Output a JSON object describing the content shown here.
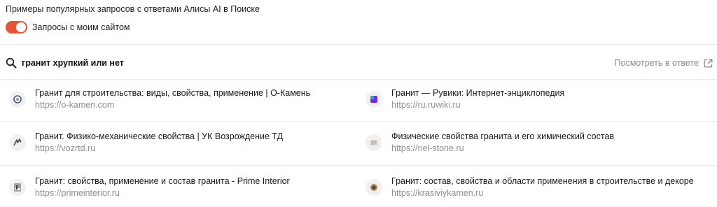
{
  "heading": "Примеры популярных запросов с ответами Алисы AI в Поиске",
  "toggle": {
    "label": "Запросы с моим сайтом",
    "on": true,
    "color": "#e8543a"
  },
  "query": {
    "text": "гранит хрупкий или нет",
    "view_answer": "Посмотреть в ответе",
    "search_icon": "search-icon",
    "external_icon": "external-link-icon"
  },
  "results": [
    {
      "title": "Гранит для строительства: виды, свойства, применение | О-Камень",
      "url": "https://o-kamen.com",
      "icon": "o-kamen-favicon"
    },
    {
      "title": "Гранит — Рувики: Интернет-энциклопедия",
      "url": "https://ru.ruwiki.ru",
      "icon": "ruwiki-favicon"
    },
    {
      "title": "Гранит. Физико-механические свойства | УК Возрождение ТД",
      "url": "https://vozrtd.ru",
      "icon": "vozrtd-favicon"
    },
    {
      "title": "Физические свойства гранита и его химический состав",
      "url": "https://riel-stone.ru",
      "icon": "riel-stone-favicon"
    },
    {
      "title": "Гранит: свойства, применение и состав гранита - Prime Interior",
      "url": "https://primeinterior.ru",
      "icon": "primeinterior-favicon"
    },
    {
      "title": "Гранит: состав, свойства и области применения в строительстве и декоре",
      "url": "https://krasiviykamen.ru",
      "icon": "krasiviykamen-favicon"
    }
  ]
}
